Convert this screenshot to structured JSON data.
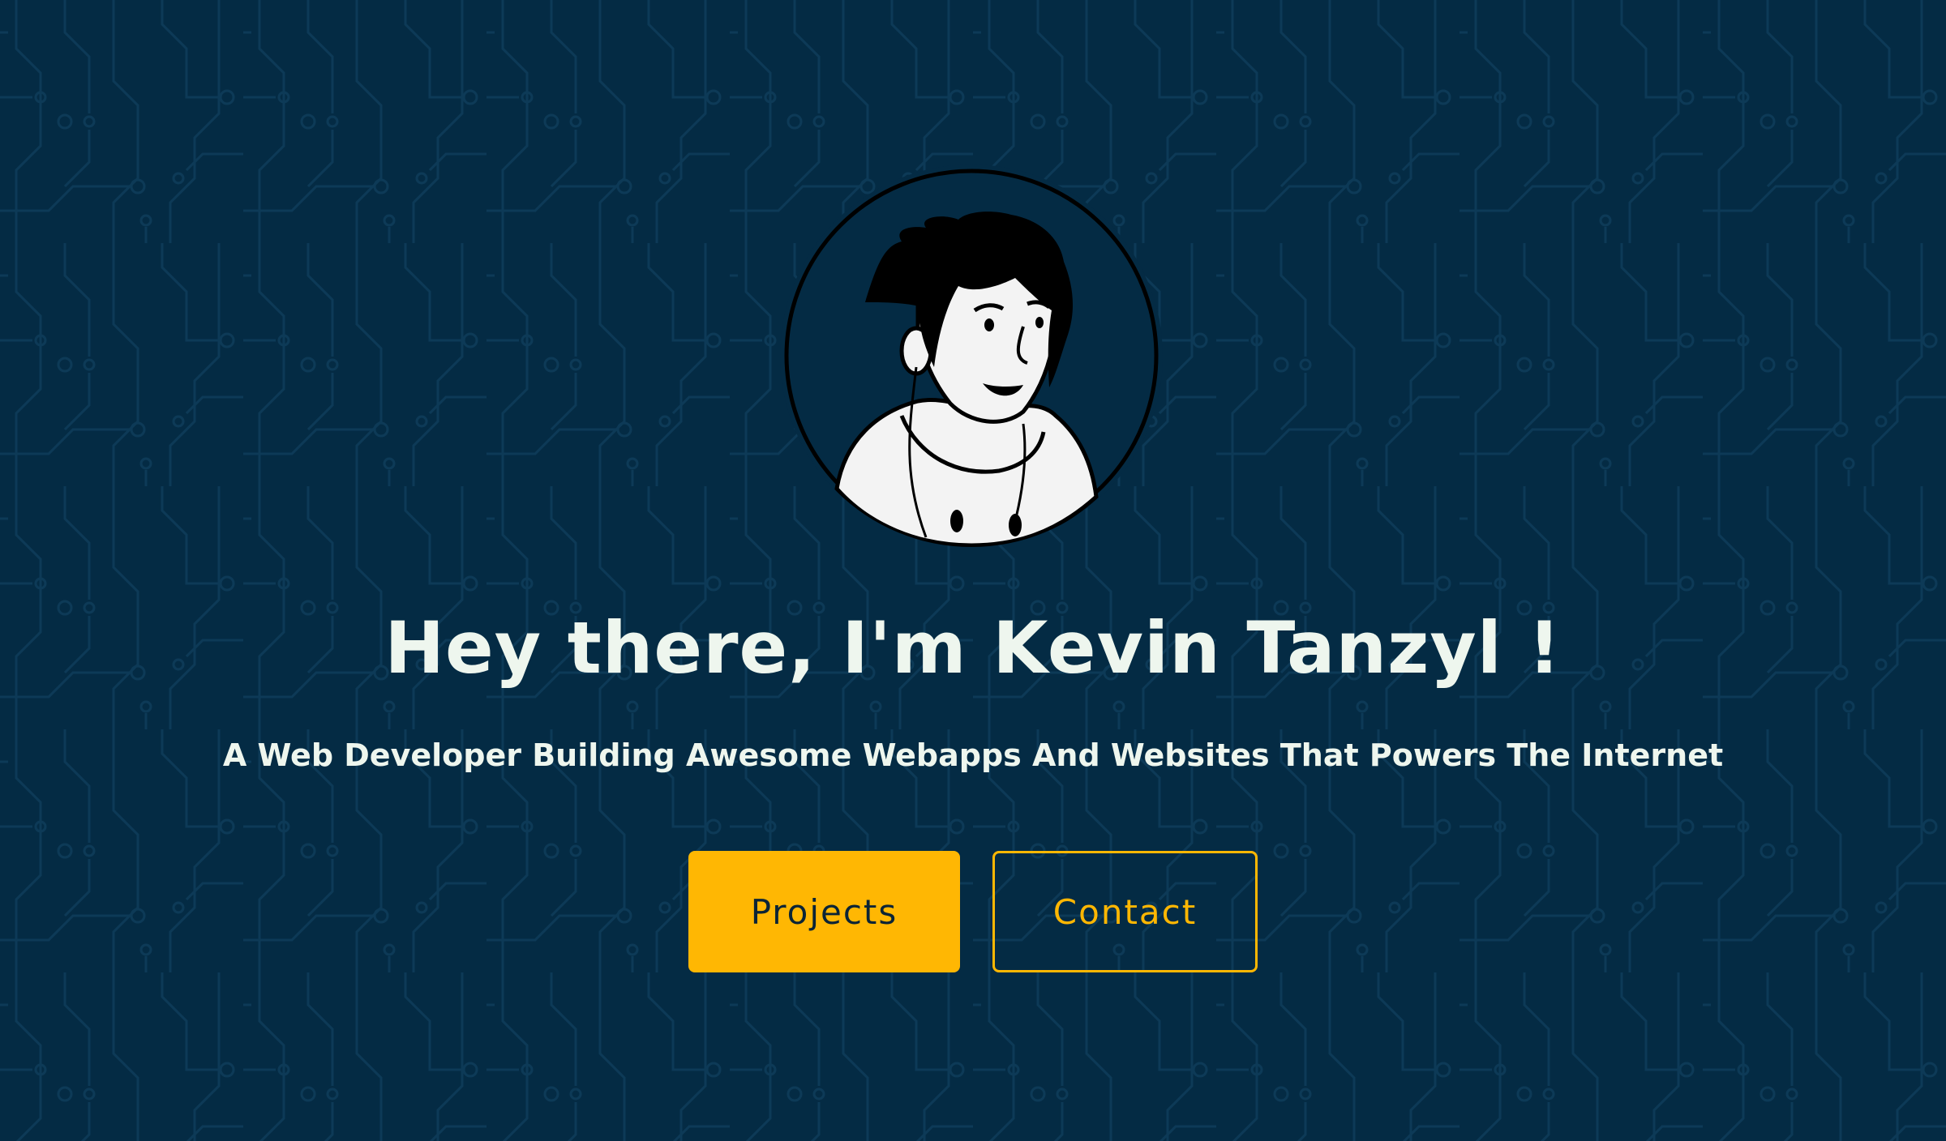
{
  "hero": {
    "title": "Hey there, I'm Kevin Tanzyl !",
    "subtitle": "A Web Developer Building Awesome Webapps And Websites That Powers The Internet"
  },
  "buttons": {
    "projects_label": "Projects",
    "contact_label": "Contact"
  },
  "colors": {
    "background": "#042b44",
    "circuit_pattern": "#0d3a57",
    "accent": "#ffb703",
    "text": "#eef6ee"
  },
  "icons": {
    "avatar": "developer-avatar-illustration",
    "background": "circuit-board-pattern"
  }
}
